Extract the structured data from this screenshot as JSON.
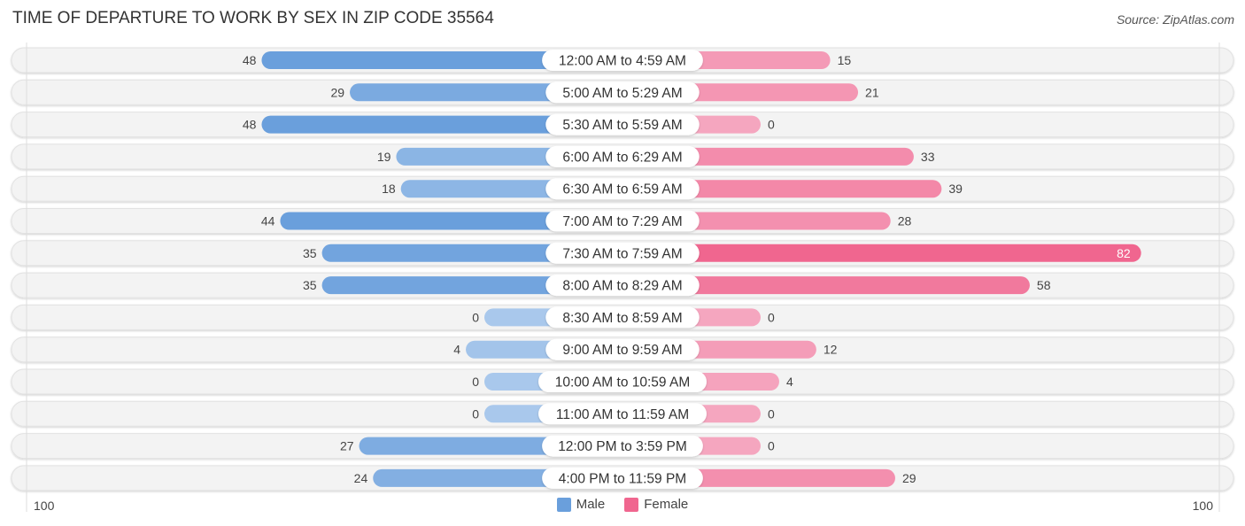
{
  "header": {
    "title": "TIME OF DEPARTURE TO WORK BY SEX IN ZIP CODE 35564",
    "source": "Source: ZipAtlas.com"
  },
  "colors": {
    "male": "#6a9fdc",
    "male_light": "#a9c8ec",
    "female": "#f0668f",
    "female_light": "#f5a6bf",
    "row_bg": "#f3f3f3"
  },
  "legend": {
    "male_label": "Male",
    "female_label": "Female"
  },
  "axis": {
    "left_label": "100",
    "right_label": "100"
  },
  "chart_data": {
    "type": "bar",
    "orientation": "horizontal-diverging",
    "title": "TIME OF DEPARTURE TO WORK BY SEX IN ZIP CODE 35564",
    "xlabel": "",
    "ylabel": "",
    "xlim": [
      -100,
      100
    ],
    "legend_position": "bottom",
    "categories": [
      "12:00 AM to 4:59 AM",
      "5:00 AM to 5:29 AM",
      "5:30 AM to 5:59 AM",
      "6:00 AM to 6:29 AM",
      "6:30 AM to 6:59 AM",
      "7:00 AM to 7:29 AM",
      "7:30 AM to 7:59 AM",
      "8:00 AM to 8:29 AM",
      "8:30 AM to 8:59 AM",
      "9:00 AM to 9:59 AM",
      "10:00 AM to 10:59 AM",
      "11:00 AM to 11:59 AM",
      "12:00 PM to 3:59 PM",
      "4:00 PM to 11:59 PM"
    ],
    "series": [
      {
        "name": "Male",
        "values": [
          48,
          29,
          48,
          19,
          18,
          44,
          35,
          35,
          0,
          4,
          0,
          0,
          27,
          24
        ]
      },
      {
        "name": "Female",
        "values": [
          15,
          21,
          0,
          33,
          39,
          28,
          82,
          58,
          0,
          12,
          4,
          0,
          0,
          29
        ]
      }
    ]
  }
}
